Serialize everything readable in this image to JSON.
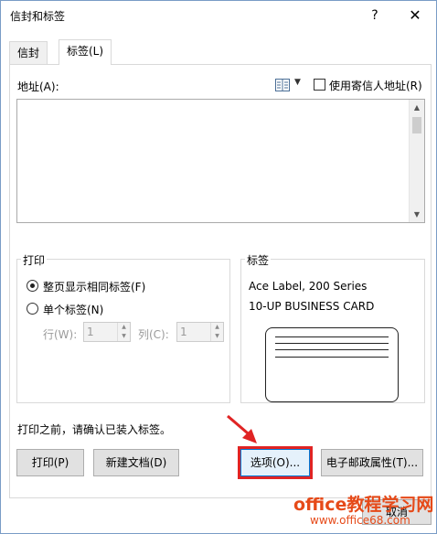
{
  "window": {
    "title": "信封和标签",
    "help": "?",
    "close": "✕"
  },
  "tabs": [
    {
      "label": "信封"
    },
    {
      "label": "标签(L)"
    }
  ],
  "address": {
    "label": "地址(A):",
    "use_return_label": "使用寄信人地址(R)",
    "use_return_checked": false,
    "value": ""
  },
  "print": {
    "title": "打印",
    "full_page": "整页显示相同标签(F)",
    "single": "单个标签(N)",
    "row_label": "行(W):",
    "row_value": "1",
    "col_label": "列(C):",
    "col_value": "1"
  },
  "label": {
    "title": "标签",
    "line1": "Ace Label, 200 Series",
    "line2": "10-UP BUSINESS CARD"
  },
  "notice": "打印之前，请确认已装入标签。",
  "buttons": {
    "print": "打印(P)",
    "new_doc": "新建文档(D)",
    "options": "选项(O)...",
    "postage": "电子邮政属性(T)...",
    "cancel": "取消"
  },
  "watermark": {
    "line1": "office教程学习网",
    "line2": "www.office68.com"
  },
  "colors": {
    "highlight": "#e02424",
    "accent": "#0078d7",
    "watermark": "#e64a19"
  },
  "icons": {
    "address_book": "address-book-icon",
    "dropdown": "chevron-down-icon"
  }
}
